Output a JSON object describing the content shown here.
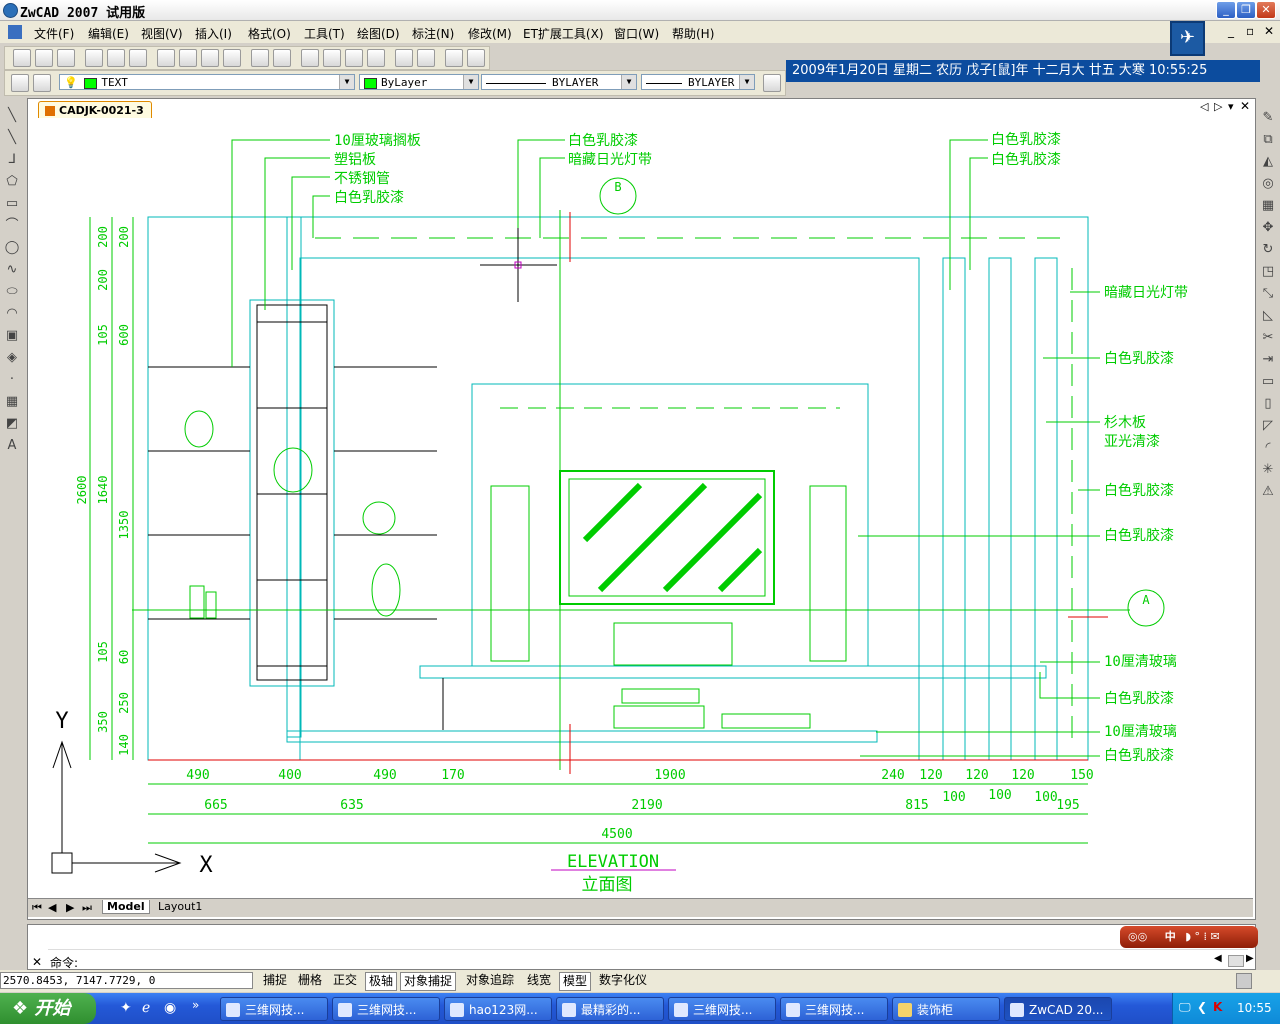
{
  "window": {
    "title": "ZwCAD 2007 试用版",
    "controls": {
      "minimize": "_",
      "restore": "❐",
      "close": "✕"
    }
  },
  "menu": [
    "文件(F)",
    "编辑(E)",
    "视图(V)",
    "插入(I)",
    "格式(O)",
    "工具(T)",
    "绘图(D)",
    "标注(N)",
    "修改(M)",
    "ET扩展工具(X)",
    "窗口(W)",
    "帮助(H)"
  ],
  "mdi_controls": [
    "_",
    "▫",
    "✕"
  ],
  "properties": {
    "text_style": "TEXT",
    "color": "ByLayer",
    "linetype": "BYLAYER",
    "lineweight": "BYLAYER",
    "swatch_color": "#00ff00"
  },
  "datebar": "2009年1月20日 星期二 农历 戊子[鼠]年 十二月大 廿五  大寒  10:55:25",
  "doc_tab": "CADJK-0021-3",
  "layout_tabs": [
    "Model",
    "Layout1"
  ],
  "command": {
    "prompt": "命令:"
  },
  "coords": "2570.8453, 7147.7729, 0",
  "status_buttons": [
    {
      "label": "捕捉",
      "pressed": false
    },
    {
      "label": "栅格",
      "pressed": false
    },
    {
      "label": "正交",
      "pressed": false
    },
    {
      "label": "极轴",
      "pressed": true
    },
    {
      "label": "对象捕捉",
      "pressed": true
    },
    {
      "label": "对象追踪",
      "pressed": false
    },
    {
      "label": "线宽",
      "pressed": false
    },
    {
      "label": "模型",
      "pressed": true
    },
    {
      "label": "数字化仪",
      "pressed": false
    }
  ],
  "taskbar": {
    "start": "开始",
    "tasks": [
      "三维网技...",
      "三维网技...",
      "hao123网...",
      "最精彩的...",
      "三维网技...",
      "三维网技...",
      "装饰柜",
      "ZwCAD 20..."
    ],
    "active_index": 7,
    "time": "10:55"
  },
  "ime": "中",
  "drawing": {
    "title_en": "ELEVATION",
    "title_cn": "立面图",
    "labels_left": [
      "10厘玻璃搁板",
      "塑铝板",
      "不锈钢管",
      "白色乳胶漆"
    ],
    "labels_top_mid": [
      "白色乳胶漆",
      "暗藏日光灯带"
    ],
    "labels_top_right": [
      "白色乳胶漆",
      "白色乳胶漆"
    ],
    "labels_right": [
      "暗藏日光灯带",
      "白色乳胶漆",
      "杉木板",
      "亚光清漆",
      "白色乳胶漆",
      "白色乳胶漆",
      "10厘清玻璃",
      "白色乳胶漆",
      "10厘清玻璃",
      "白色乳胶漆"
    ],
    "section_marks": [
      "B",
      "A"
    ],
    "dims_vertical_outer": [
      "2600"
    ],
    "dims_vertical_mid": [
      "200",
      "200",
      "105",
      "1640",
      "105",
      "350"
    ],
    "dims_vertical_inner": [
      "200",
      "600",
      "1350",
      "60",
      "250",
      "140"
    ],
    "dims_row1": [
      "490",
      "400",
      "490",
      "170",
      "1900",
      "240",
      "120",
      "120",
      "120",
      "150"
    ],
    "dims_row1b": [
      "100",
      "100",
      "100"
    ],
    "dims_row2": [
      "665",
      "635",
      "2190",
      "815",
      "195"
    ],
    "dims_total": "4500",
    "ucs": {
      "x": "X",
      "y": "Y"
    }
  }
}
